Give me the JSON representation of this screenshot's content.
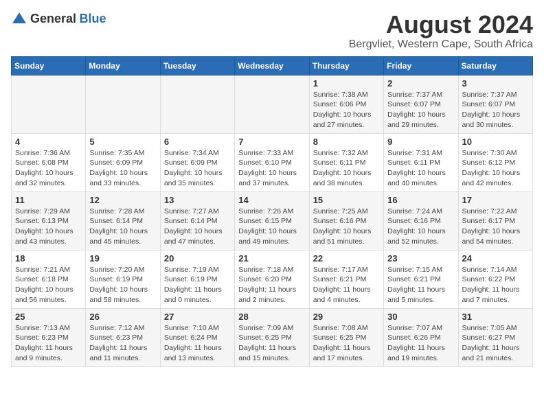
{
  "header": {
    "logo_general": "General",
    "logo_blue": "Blue",
    "title": "August 2024",
    "subtitle": "Bergvliet, Western Cape, South Africa"
  },
  "days_of_week": [
    "Sunday",
    "Monday",
    "Tuesday",
    "Wednesday",
    "Thursday",
    "Friday",
    "Saturday"
  ],
  "weeks": [
    {
      "days": [
        {
          "number": "",
          "info": ""
        },
        {
          "number": "",
          "info": ""
        },
        {
          "number": "",
          "info": ""
        },
        {
          "number": "",
          "info": ""
        },
        {
          "number": "1",
          "info": "Sunrise: 7:38 AM\nSunset: 6:06 PM\nDaylight: 10 hours and 27 minutes."
        },
        {
          "number": "2",
          "info": "Sunrise: 7:37 AM\nSunset: 6:07 PM\nDaylight: 10 hours and 29 minutes."
        },
        {
          "number": "3",
          "info": "Sunrise: 7:37 AM\nSunset: 6:07 PM\nDaylight: 10 hours and 30 minutes."
        }
      ]
    },
    {
      "days": [
        {
          "number": "4",
          "info": "Sunrise: 7:36 AM\nSunset: 6:08 PM\nDaylight: 10 hours and 32 minutes."
        },
        {
          "number": "5",
          "info": "Sunrise: 7:35 AM\nSunset: 6:09 PM\nDaylight: 10 hours and 33 minutes."
        },
        {
          "number": "6",
          "info": "Sunrise: 7:34 AM\nSunset: 6:09 PM\nDaylight: 10 hours and 35 minutes."
        },
        {
          "number": "7",
          "info": "Sunrise: 7:33 AM\nSunset: 6:10 PM\nDaylight: 10 hours and 37 minutes."
        },
        {
          "number": "8",
          "info": "Sunrise: 7:32 AM\nSunset: 6:11 PM\nDaylight: 10 hours and 38 minutes."
        },
        {
          "number": "9",
          "info": "Sunrise: 7:31 AM\nSunset: 6:11 PM\nDaylight: 10 hours and 40 minutes."
        },
        {
          "number": "10",
          "info": "Sunrise: 7:30 AM\nSunset: 6:12 PM\nDaylight: 10 hours and 42 minutes."
        }
      ]
    },
    {
      "days": [
        {
          "number": "11",
          "info": "Sunrise: 7:29 AM\nSunset: 6:13 PM\nDaylight: 10 hours and 43 minutes."
        },
        {
          "number": "12",
          "info": "Sunrise: 7:28 AM\nSunset: 6:14 PM\nDaylight: 10 hours and 45 minutes."
        },
        {
          "number": "13",
          "info": "Sunrise: 7:27 AM\nSunset: 6:14 PM\nDaylight: 10 hours and 47 minutes."
        },
        {
          "number": "14",
          "info": "Sunrise: 7:26 AM\nSunset: 6:15 PM\nDaylight: 10 hours and 49 minutes."
        },
        {
          "number": "15",
          "info": "Sunrise: 7:25 AM\nSunset: 6:16 PM\nDaylight: 10 hours and 51 minutes."
        },
        {
          "number": "16",
          "info": "Sunrise: 7:24 AM\nSunset: 6:16 PM\nDaylight: 10 hours and 52 minutes."
        },
        {
          "number": "17",
          "info": "Sunrise: 7:22 AM\nSunset: 6:17 PM\nDaylight: 10 hours and 54 minutes."
        }
      ]
    },
    {
      "days": [
        {
          "number": "18",
          "info": "Sunrise: 7:21 AM\nSunset: 6:18 PM\nDaylight: 10 hours and 56 minutes."
        },
        {
          "number": "19",
          "info": "Sunrise: 7:20 AM\nSunset: 6:19 PM\nDaylight: 10 hours and 58 minutes."
        },
        {
          "number": "20",
          "info": "Sunrise: 7:19 AM\nSunset: 6:19 PM\nDaylight: 11 hours and 0 minutes."
        },
        {
          "number": "21",
          "info": "Sunrise: 7:18 AM\nSunset: 6:20 PM\nDaylight: 11 hours and 2 minutes."
        },
        {
          "number": "22",
          "info": "Sunrise: 7:17 AM\nSunset: 6:21 PM\nDaylight: 11 hours and 4 minutes."
        },
        {
          "number": "23",
          "info": "Sunrise: 7:15 AM\nSunset: 6:21 PM\nDaylight: 11 hours and 5 minutes."
        },
        {
          "number": "24",
          "info": "Sunrise: 7:14 AM\nSunset: 6:22 PM\nDaylight: 11 hours and 7 minutes."
        }
      ]
    },
    {
      "days": [
        {
          "number": "25",
          "info": "Sunrise: 7:13 AM\nSunset: 6:23 PM\nDaylight: 11 hours and 9 minutes."
        },
        {
          "number": "26",
          "info": "Sunrise: 7:12 AM\nSunset: 6:23 PM\nDaylight: 11 hours and 11 minutes."
        },
        {
          "number": "27",
          "info": "Sunrise: 7:10 AM\nSunset: 6:24 PM\nDaylight: 11 hours and 13 minutes."
        },
        {
          "number": "28",
          "info": "Sunrise: 7:09 AM\nSunset: 6:25 PM\nDaylight: 11 hours and 15 minutes."
        },
        {
          "number": "29",
          "info": "Sunrise: 7:08 AM\nSunset: 6:25 PM\nDaylight: 11 hours and 17 minutes."
        },
        {
          "number": "30",
          "info": "Sunrise: 7:07 AM\nSunset: 6:26 PM\nDaylight: 11 hours and 19 minutes."
        },
        {
          "number": "31",
          "info": "Sunrise: 7:05 AM\nSunset: 6:27 PM\nDaylight: 11 hours and 21 minutes."
        }
      ]
    }
  ]
}
